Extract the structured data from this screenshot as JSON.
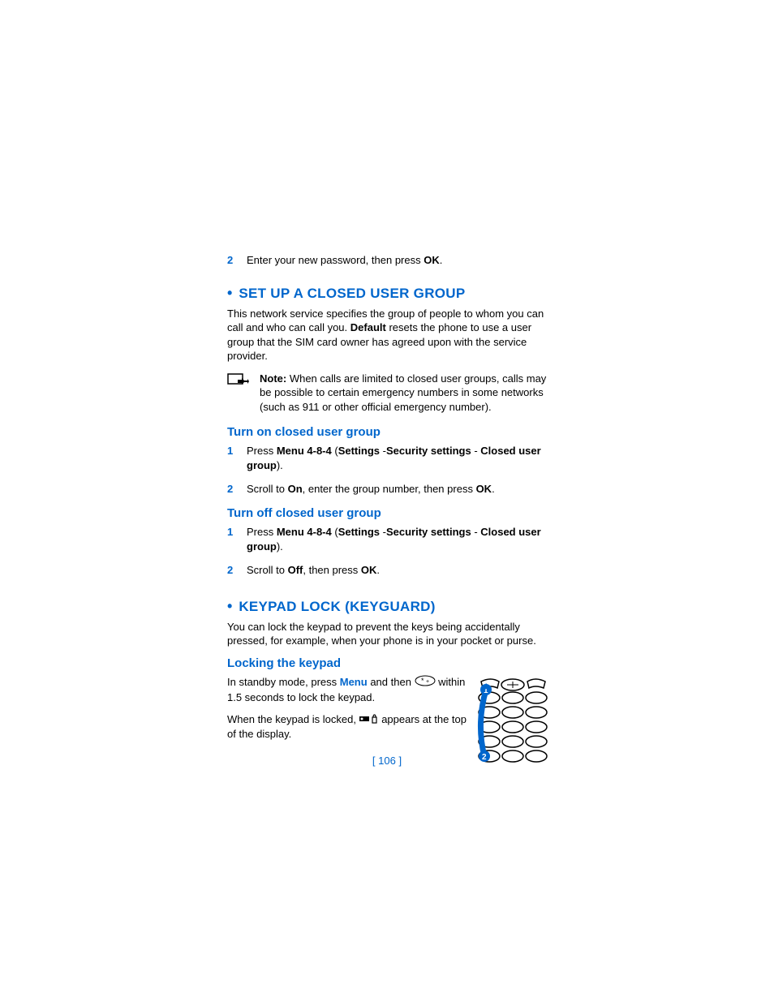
{
  "step2": {
    "num": "2",
    "text_a": "Enter your new password, then press ",
    "ok": "OK",
    "dot": "."
  },
  "sec1": {
    "bullet": "•",
    "title": "SET UP A CLOSED USER GROUP",
    "para_a": "This network service specifies the group of people to whom you can call and who can call you. ",
    "default": "Default",
    "para_b": " resets the phone to use a user group that the SIM card owner has agreed upon with the service provider.",
    "note_label": "Note:",
    "note_text": " When calls are limited to closed user groups, calls may be possible to certain emergency numbers in some networks (such as 911 or other official emergency number).",
    "sub1": {
      "title": "Turn on closed user group",
      "s1": {
        "num": "1",
        "a": "Press ",
        "b": "Menu 4-8-4",
        "c": " (",
        "d": "Settings",
        "e": " -",
        "f": "Security settings",
        "g": " - ",
        "h": "Closed user group",
        "i": ")."
      },
      "s2": {
        "num": "2",
        "a": "Scroll to ",
        "b": "On",
        "c": ", enter the group number, then press ",
        "d": "OK",
        "e": "."
      }
    },
    "sub2": {
      "title": "Turn off closed user group",
      "s1": {
        "num": "1",
        "a": "Press ",
        "b": "Menu 4-8-4",
        "c": " (",
        "d": "Settings",
        "e": " -",
        "f": "Security settings",
        "g": " - ",
        "h": "Closed user group",
        "i": ")."
      },
      "s2": {
        "num": "2",
        "a": "Scroll to ",
        "b": "Off",
        "c": ", then press ",
        "d": "OK",
        "e": "."
      }
    }
  },
  "sec2": {
    "bullet": "•",
    "title": "KEYPAD LOCK (KEYGUARD)",
    "para": "You can lock the keypad to prevent the keys being accidentally pressed, for example, when your phone is in your pocket or purse.",
    "sub": {
      "title": "Locking the keypad",
      "p1a": "In standby mode, press ",
      "p1b": "Menu",
      "p1c": " and then ",
      "p1d": " within 1.5 seconds to lock the keypad.",
      "p2a": "When the keypad is locked, ",
      "p2b": " appears at the top of the display."
    }
  },
  "footer": "[ 106 ]"
}
